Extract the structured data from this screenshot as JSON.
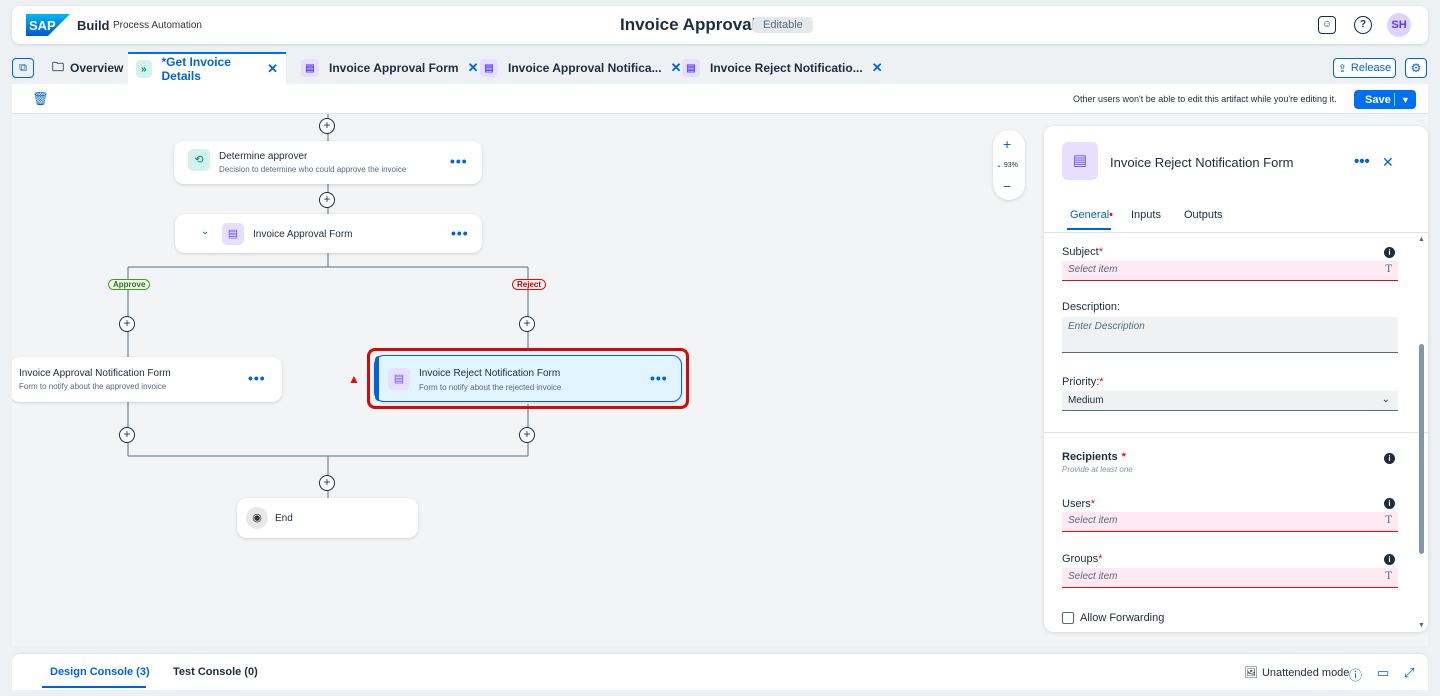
{
  "shell": {
    "logo": "SAP",
    "brand": "Build",
    "brand_sub": "Process Automation",
    "title": "Invoice Approval",
    "badge": "Editable",
    "avatar": "SH",
    "icons": [
      "feedback-icon",
      "help-icon"
    ]
  },
  "tabs": [
    {
      "label": "Overview",
      "icon": "folder-icon"
    },
    {
      "label": "*Get Invoice Details",
      "icon": "process-icon",
      "active": true
    },
    {
      "label": "Invoice Approval Form",
      "icon": "form-icon"
    },
    {
      "label": "Invoice Approval Notifica...",
      "icon": "form-icon"
    },
    {
      "label": "Invoice Reject Notificatio...",
      "icon": "form-icon"
    }
  ],
  "release_label": "Release",
  "toolbar": {
    "lock_message": "Other users won't be able to edit this artifact while you're editing it.",
    "save_label": "Save"
  },
  "canvas": {
    "zoom": "93%",
    "nodes": {
      "determine": {
        "title": "Determine approver",
        "desc": "Decision to determine who could approve the invoice"
      },
      "approval_form": {
        "title": "Invoice Approval Form"
      },
      "approval_notif": {
        "title": "Invoice Approval Notification Form",
        "desc": "Form to notify about the approved invoice"
      },
      "reject_notif": {
        "title": "Invoice Reject Notification Form",
        "desc": "Form to notify about the rejected invoice"
      },
      "end": {
        "title": "End"
      }
    },
    "branches": {
      "approve": "Approve",
      "reject": "Reject"
    }
  },
  "panel": {
    "title": "Invoice Reject Notification Form",
    "tabs": {
      "general": "General",
      "inputs": "Inputs",
      "outputs": "Outputs"
    },
    "subject": {
      "label": "Subject",
      "placeholder": "Select item"
    },
    "description": {
      "label": "Description:",
      "placeholder": "Enter Description"
    },
    "priority": {
      "label": "Priority:",
      "value": "Medium"
    },
    "recipients": {
      "title": "Recipients",
      "subtitle": "Provide at least one"
    },
    "users": {
      "label": "Users",
      "placeholder": "Select item"
    },
    "groups": {
      "label": "Groups",
      "placeholder": "Select item"
    },
    "allow_forwarding": "Allow Forwarding"
  },
  "console": {
    "design": "Design Console (3)",
    "test": "Test Console (0)",
    "unattended": "Unattended mode"
  },
  "colors": {
    "accent": "#0070f2",
    "error": "#e90b0b",
    "highlight": "#d20a0a"
  }
}
